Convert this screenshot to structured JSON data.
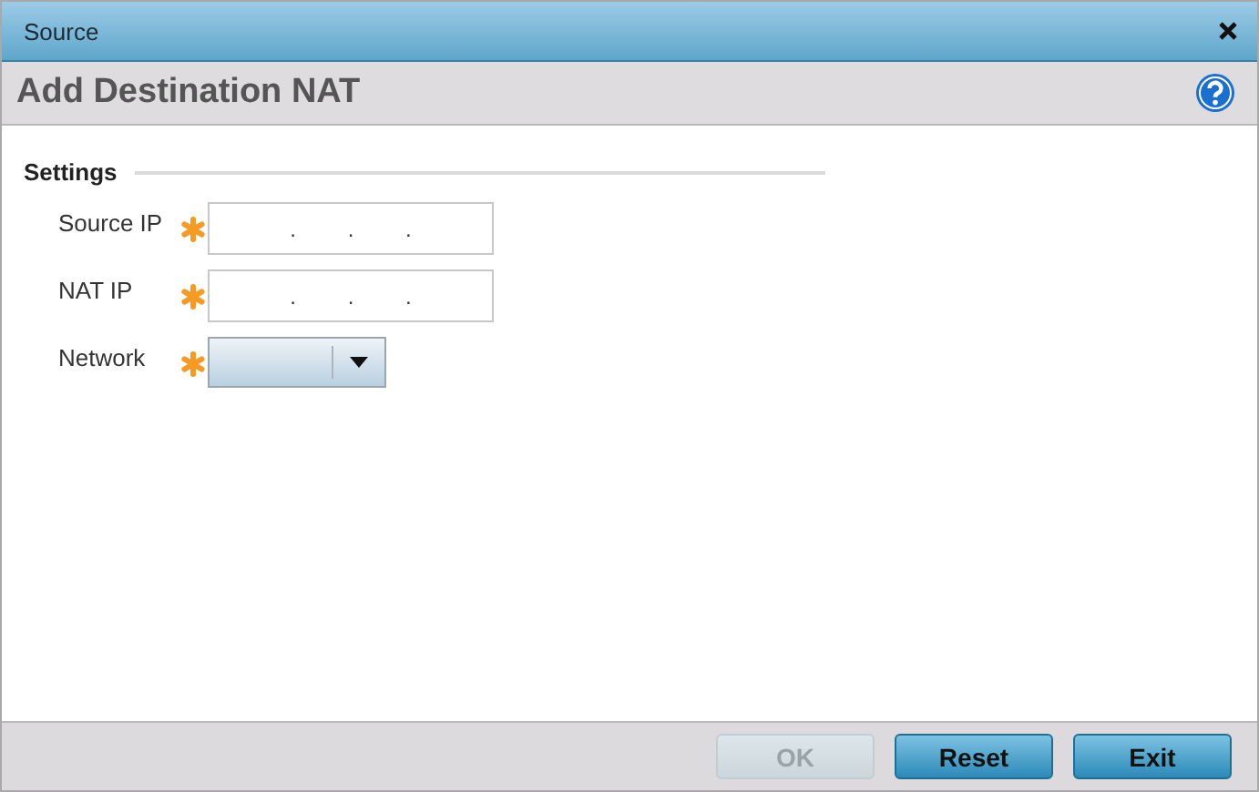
{
  "window": {
    "title": "Source"
  },
  "header": {
    "title": "Add Destination NAT"
  },
  "section": {
    "title": "Settings"
  },
  "fields": [
    {
      "label": "Source IP",
      "kind": "ip",
      "required": true,
      "separators": [
        ".",
        ".",
        "."
      ]
    },
    {
      "label": "NAT IP",
      "kind": "ip",
      "required": true,
      "separators": [
        ".",
        ".",
        "."
      ]
    },
    {
      "label": "Network",
      "kind": "select",
      "required": true
    }
  ],
  "buttons": [
    {
      "label": "OK",
      "disabled": true
    },
    {
      "label": "Reset",
      "disabled": false
    },
    {
      "label": "Exit",
      "disabled": false
    }
  ]
}
